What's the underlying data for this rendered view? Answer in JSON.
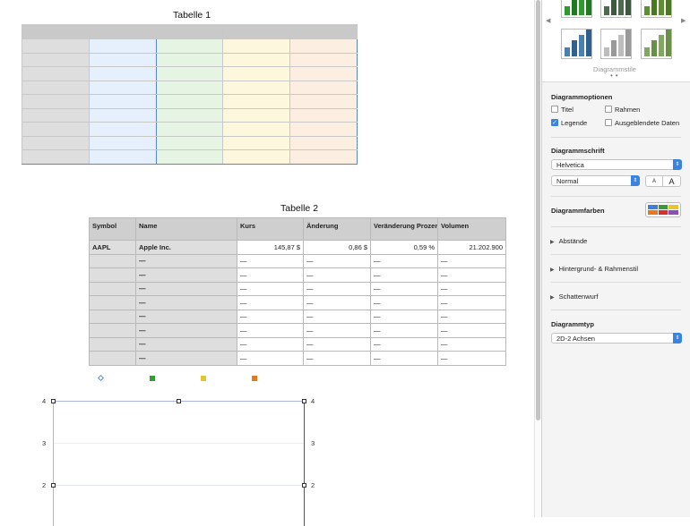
{
  "table1": {
    "title": "Tabelle 1",
    "rows": 9,
    "columns": 5
  },
  "table2": {
    "title": "Tabelle 2",
    "headers": [
      "Symbol",
      "Name",
      "Kurs",
      "Änderung",
      "Veränderung Prozent",
      "Volumen"
    ],
    "rows": [
      [
        "AAPL",
        "Apple Inc.",
        "145,87 $",
        "0,86 $",
        "0,59 %",
        "21.202.900"
      ],
      [
        "",
        "—",
        "—",
        "—",
        "—",
        "—"
      ],
      [
        "",
        "—",
        "—",
        "—",
        "—",
        "—"
      ],
      [
        "",
        "—",
        "—",
        "—",
        "—",
        "—"
      ],
      [
        "",
        "—",
        "—",
        "—",
        "—",
        "—"
      ],
      [
        "",
        "—",
        "—",
        "—",
        "—",
        "—"
      ],
      [
        "",
        "—",
        "—",
        "—",
        "—",
        "—"
      ],
      [
        "",
        "—",
        "—",
        "—",
        "—",
        "—"
      ],
      [
        "",
        "—",
        "—",
        "—",
        "—",
        "—"
      ]
    ]
  },
  "chart": {
    "legend_colors": [
      "#5b8fd6",
      "#3a9a3a",
      "#e8c430",
      "#e8781e"
    ],
    "left_ticks": [
      "4",
      "3",
      "2"
    ],
    "right_ticks": [
      "4",
      "3",
      "2"
    ]
  },
  "sidebar": {
    "styles_label": "Diagrammstile",
    "options_title": "Diagrammoptionen",
    "options": [
      {
        "label": "Titel",
        "checked": false
      },
      {
        "label": "Rahmen",
        "checked": false
      },
      {
        "label": "Legende",
        "checked": true
      },
      {
        "label": "Ausgeblendete Daten",
        "checked": false
      }
    ],
    "font_title": "Diagrammschrift",
    "font_family": "Helvetica",
    "font_style": "Normal",
    "font_smaller": "A",
    "font_larger": "A",
    "colors_title": "Diagrammfarben",
    "spacing": "Abstände",
    "background": "Hintergrund- & Rahmenstil",
    "shadow": "Schattenwurf",
    "type_title": "Diagrammtyp",
    "type_value": "2D-2 Achsen"
  }
}
